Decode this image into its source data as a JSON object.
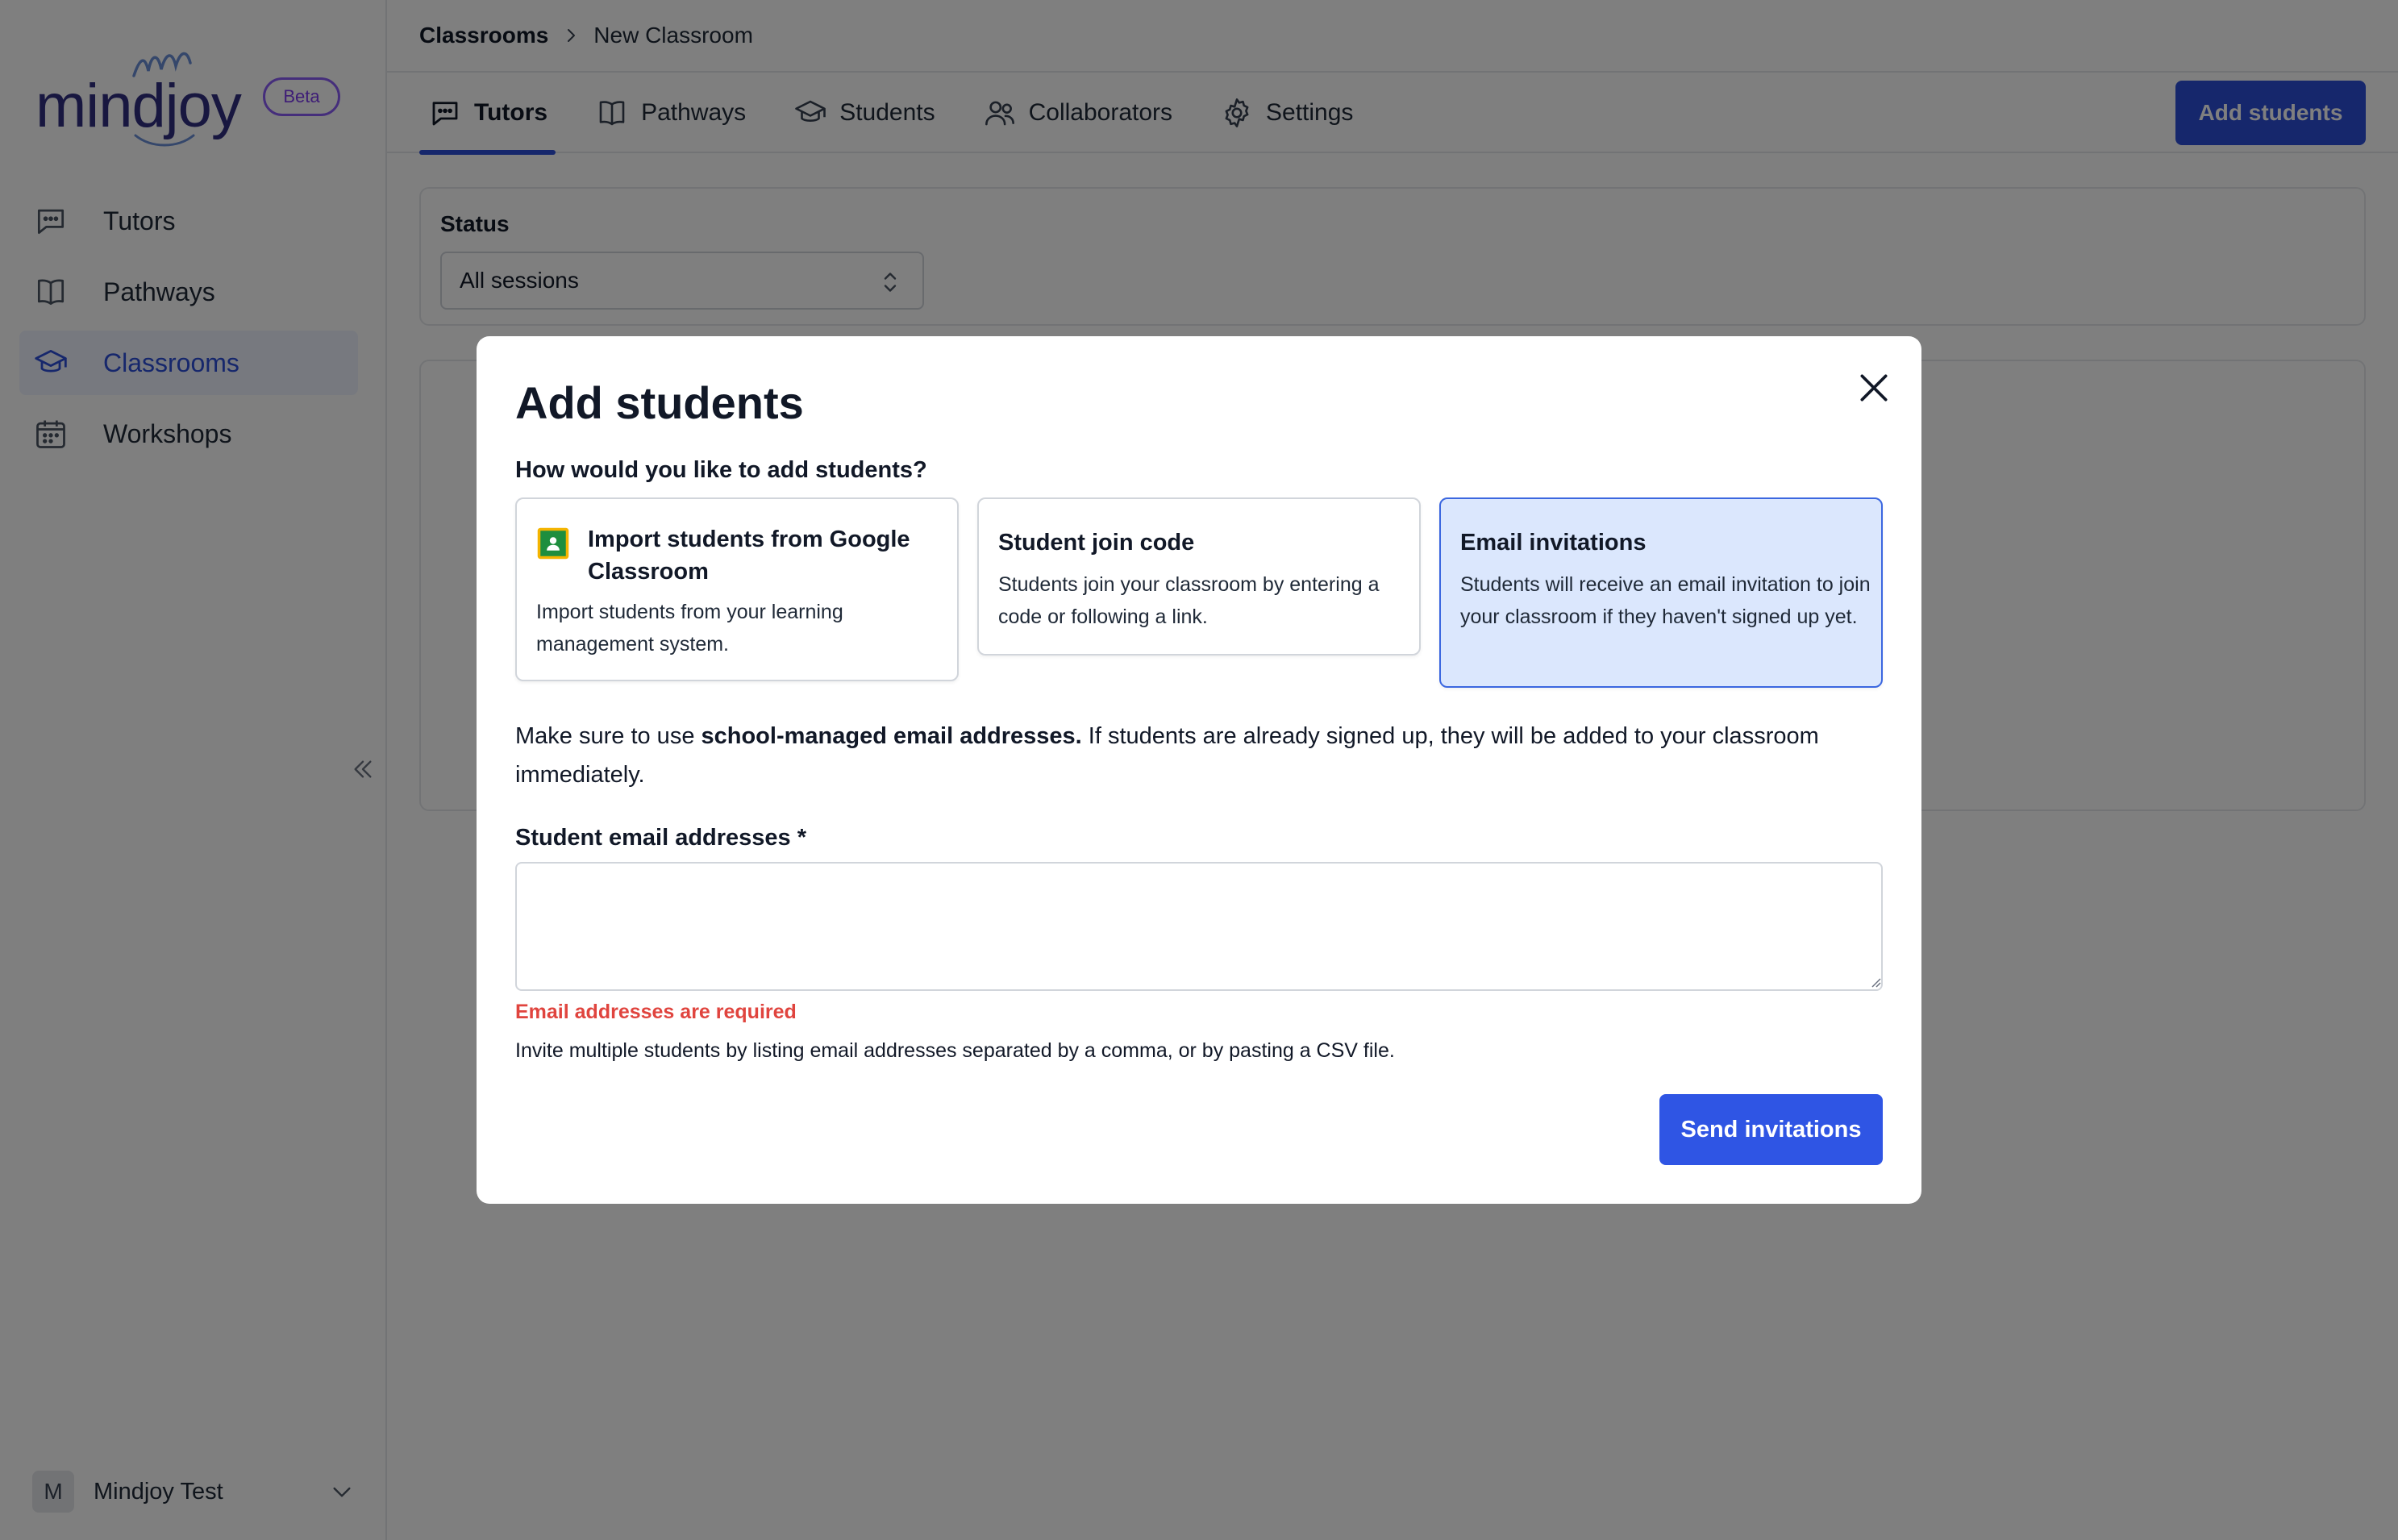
{
  "brand": {
    "name": "mindjoy",
    "badge": "Beta"
  },
  "sidebar": {
    "items": [
      {
        "label": "Tutors",
        "icon": "chat-icon"
      },
      {
        "label": "Pathways",
        "icon": "book-icon"
      },
      {
        "label": "Classrooms",
        "icon": "graduation-cap-icon",
        "active": true
      },
      {
        "label": "Workshops",
        "icon": "calendar-icon"
      }
    ],
    "user": {
      "initial": "M",
      "name": "Mindjoy Test"
    }
  },
  "breadcrumb": {
    "parent": "Classrooms",
    "current": "New Classroom"
  },
  "tabs": [
    {
      "label": "Tutors",
      "active": true
    },
    {
      "label": "Pathways"
    },
    {
      "label": "Students"
    },
    {
      "label": "Collaborators"
    },
    {
      "label": "Settings"
    }
  ],
  "header": {
    "add_students_label": "Add students"
  },
  "filter": {
    "status_label": "Status",
    "status_value": "All sessions"
  },
  "modal": {
    "title": "Add students",
    "question": "How would you like to add students?",
    "options": [
      {
        "title": "Import students from Google Classroom",
        "description": "Import students from your learning management system."
      },
      {
        "title": "Student join code",
        "description": "Students join your classroom by entering a code or following a link."
      },
      {
        "title": "Email invitations",
        "description": "Students will receive an email invitation to join your classroom if they haven't signed up yet.",
        "selected": true
      }
    ],
    "notice_prefix": "Make sure to use ",
    "notice_bold": "school-managed email addresses.",
    "notice_suffix": " If students are already signed up, they will be added to your classroom immediately.",
    "email_label": "Student email addresses *",
    "email_value": "",
    "error": "Email addresses are required",
    "help": "Invite multiple students by listing email addresses separated by a comma, or by pasting a CSV file.",
    "send_label": "Send invitations"
  },
  "colors": {
    "accent": "#2d4ed8",
    "error": "#e0443e",
    "selected_bg": "#dbe7fd",
    "beta": "#8b5cf6"
  }
}
